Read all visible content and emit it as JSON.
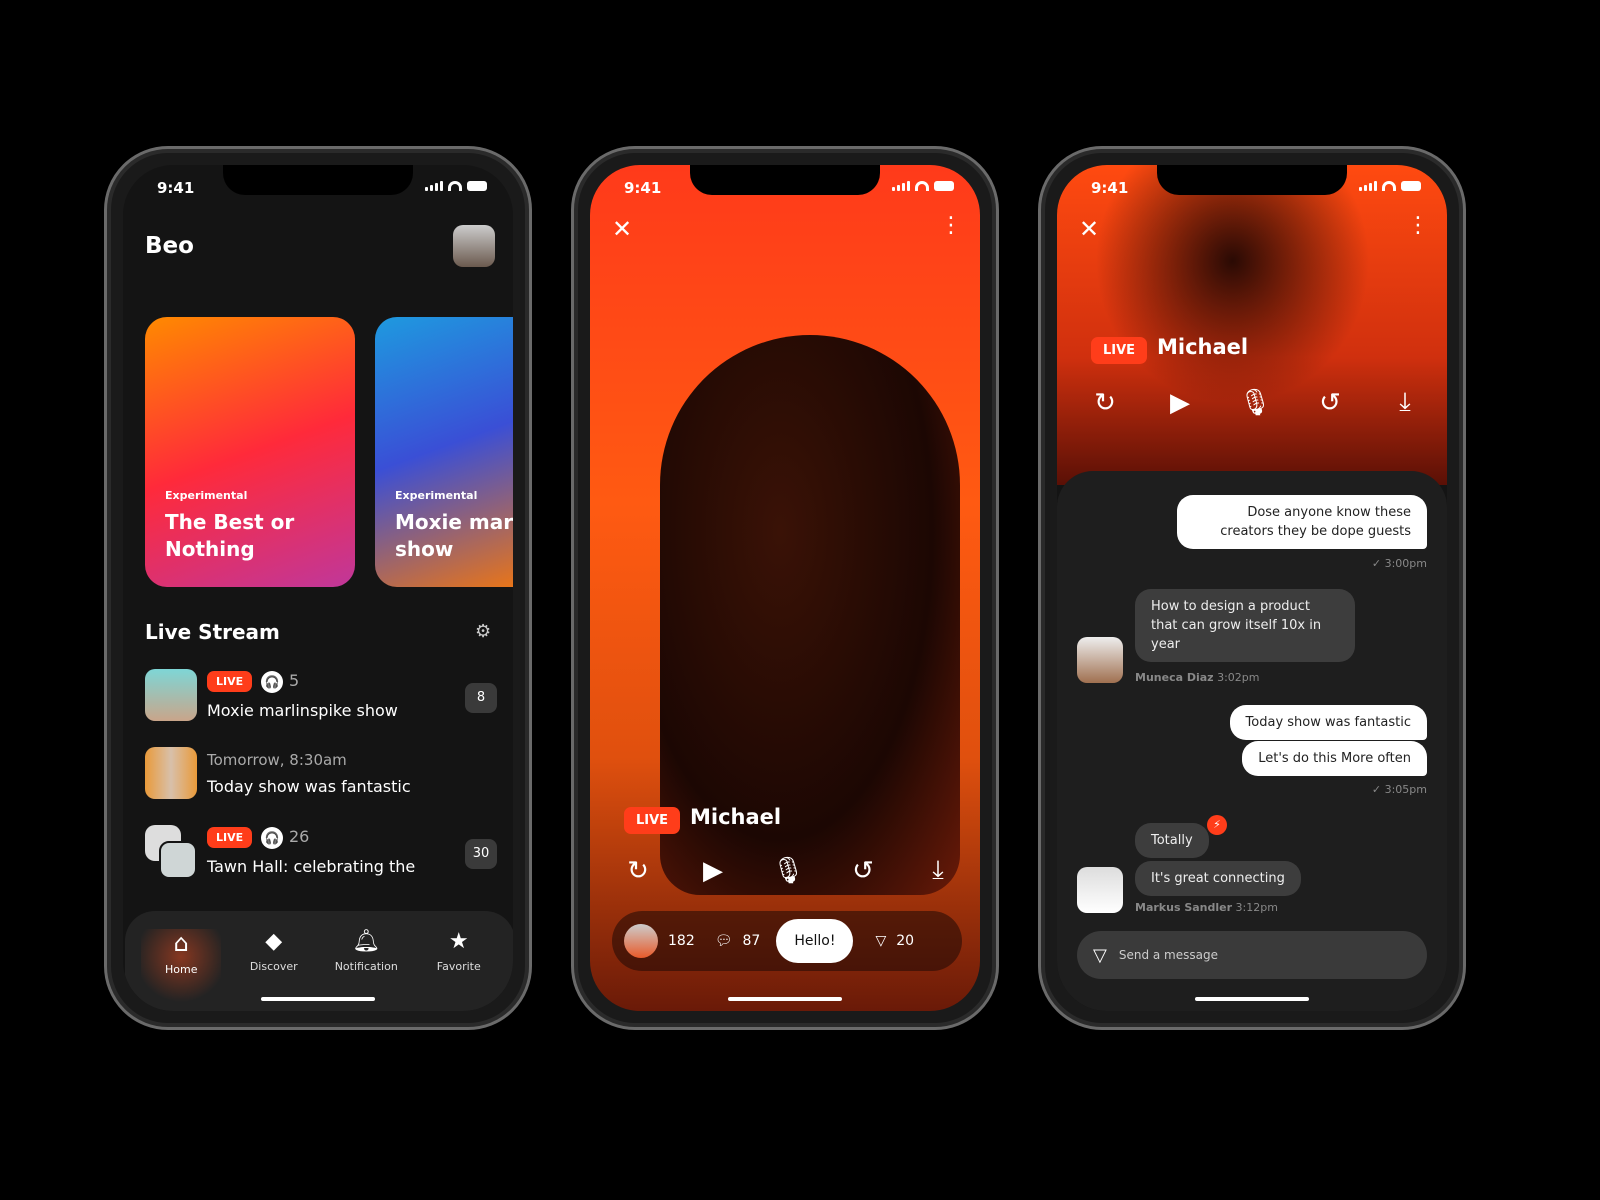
{
  "status": {
    "time": "9:41"
  },
  "home": {
    "title": "Beo",
    "cards": [
      {
        "category": "Experimental",
        "title": "The Best or Nothing"
      },
      {
        "category": "Experimental",
        "title": "Moxie marl show"
      }
    ],
    "section_title": "Live Stream",
    "filter_icon": "sliders-icon",
    "streams": [
      {
        "live": "LIVE",
        "listeners": "5",
        "title": "Moxie marlinspike show",
        "badge": "8"
      },
      {
        "subtitle": "Tomorrow, 8:30am",
        "title": "Today show was fantastic"
      },
      {
        "live": "LIVE",
        "listeners": "26",
        "title": "Tawn Hall: celebrating the",
        "badge": "30"
      }
    ],
    "nav": [
      {
        "label": "Home",
        "icon": "home-icon"
      },
      {
        "label": "Discover",
        "icon": "diamond-icon"
      },
      {
        "label": "Notification",
        "icon": "bell-icon"
      },
      {
        "label": "Favorite",
        "icon": "star-list-icon"
      }
    ]
  },
  "stream": {
    "live": "LIVE",
    "name": "Michael",
    "viewers": "182",
    "comments": "87",
    "hello": "Hello!",
    "shares": "20"
  },
  "chat": {
    "live": "LIVE",
    "name": "Michael",
    "messages": [
      {
        "text": "Dose anyone know these creators they be dope guests",
        "time": "3:00pm"
      },
      {
        "text": "How to design a product that can grow itself 10x in year",
        "author": "Muneca Diaz",
        "time": "3:02pm"
      },
      {
        "text": "Today show was fantastic"
      },
      {
        "text": "Let's do this More often",
        "time": "3:05pm"
      },
      {
        "text": "Totally"
      },
      {
        "text": "It's great connecting",
        "author": "Markus Sandler",
        "time": "3:12pm"
      }
    ],
    "placeholder": "Send a message"
  },
  "colors": {
    "accent": "#ff3d1a",
    "bg": "#141414"
  }
}
